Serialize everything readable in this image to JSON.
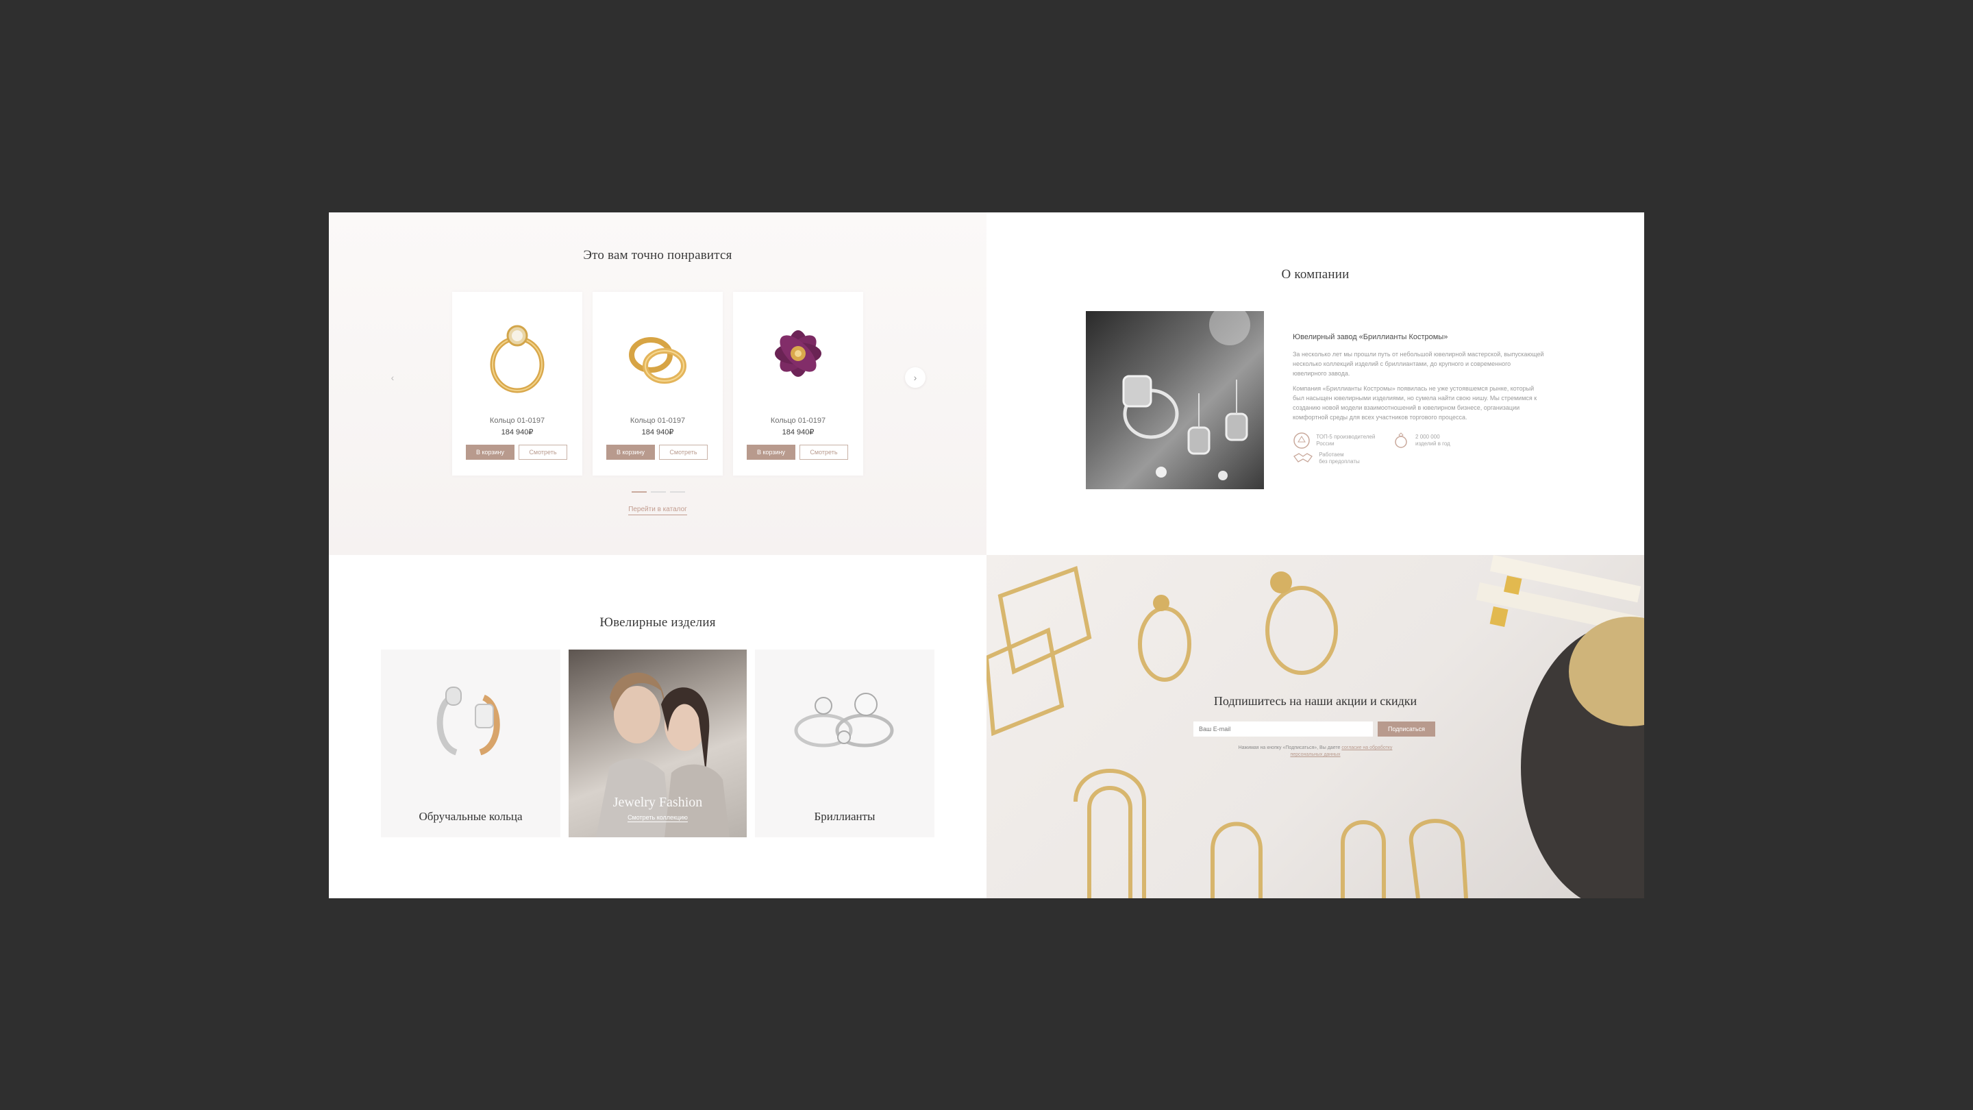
{
  "recommend": {
    "title": "Это вам точно понравится",
    "products": [
      {
        "name": "Кольцо 01-0197",
        "price": "184 940₽",
        "cart_label": "В корзину",
        "view_label": "Смотреть"
      },
      {
        "name": "Кольцо 01-0197",
        "price": "184 940₽",
        "cart_label": "В корзину",
        "view_label": "Смотреть"
      },
      {
        "name": "Кольцо 01-0197",
        "price": "184 940₽",
        "cart_label": "В корзину",
        "view_label": "Смотреть"
      }
    ],
    "prev_icon": "‹",
    "next_icon": "›",
    "catalog_link": "Перейти в каталог"
  },
  "about": {
    "title": "О компании",
    "heading": "Ювелирный завод «Бриллианты Костромы»",
    "paragraph1": "За несколько лет мы прошли путь от небольшой ювелирной мастерской, выпускающей несколько коллекций изделий с бриллиантами, до крупного и современного ювелирного завода.",
    "paragraph2": "Компания «Бриллианты Костромы» появилась не уже устоявшемся рынке, который был насыщен ювелирными изделиями, но сумела найти свою нишу. Мы стремимся к созданию новой модели взаимоотношений в ювелирном бизнесе, организации комфортной среды для всех участников торгового процесса.",
    "features": [
      {
        "line1": "ТОП-5 производителей",
        "line2": "России",
        "icon": "crest-icon"
      },
      {
        "line1": "2 000 000",
        "line2": "изделий в год",
        "icon": "ring-icon"
      },
      {
        "line1": "Работаем",
        "line2": "без предоплаты",
        "icon": "handshake-icon"
      }
    ]
  },
  "categories": {
    "title": "Ювелирные изделия",
    "items": [
      {
        "label": "Обручальные кольца"
      },
      {
        "label": "Jewelry Fashion",
        "link": "Смотреть коллекцию"
      },
      {
        "label": "Бриллианты"
      }
    ]
  },
  "subscribe": {
    "title": "Подпишитесь на наши акции и скидки",
    "placeholder": "Ваш E-mail",
    "button": "Подписаться",
    "note_prefix": "Нажимая на кнопку «Подписаться», Вы даете",
    "note_link1": "согласие на обработку",
    "note_link2": "персональных данных"
  },
  "colors": {
    "accent": "#b89a8d",
    "background": "#2f2f2f"
  }
}
